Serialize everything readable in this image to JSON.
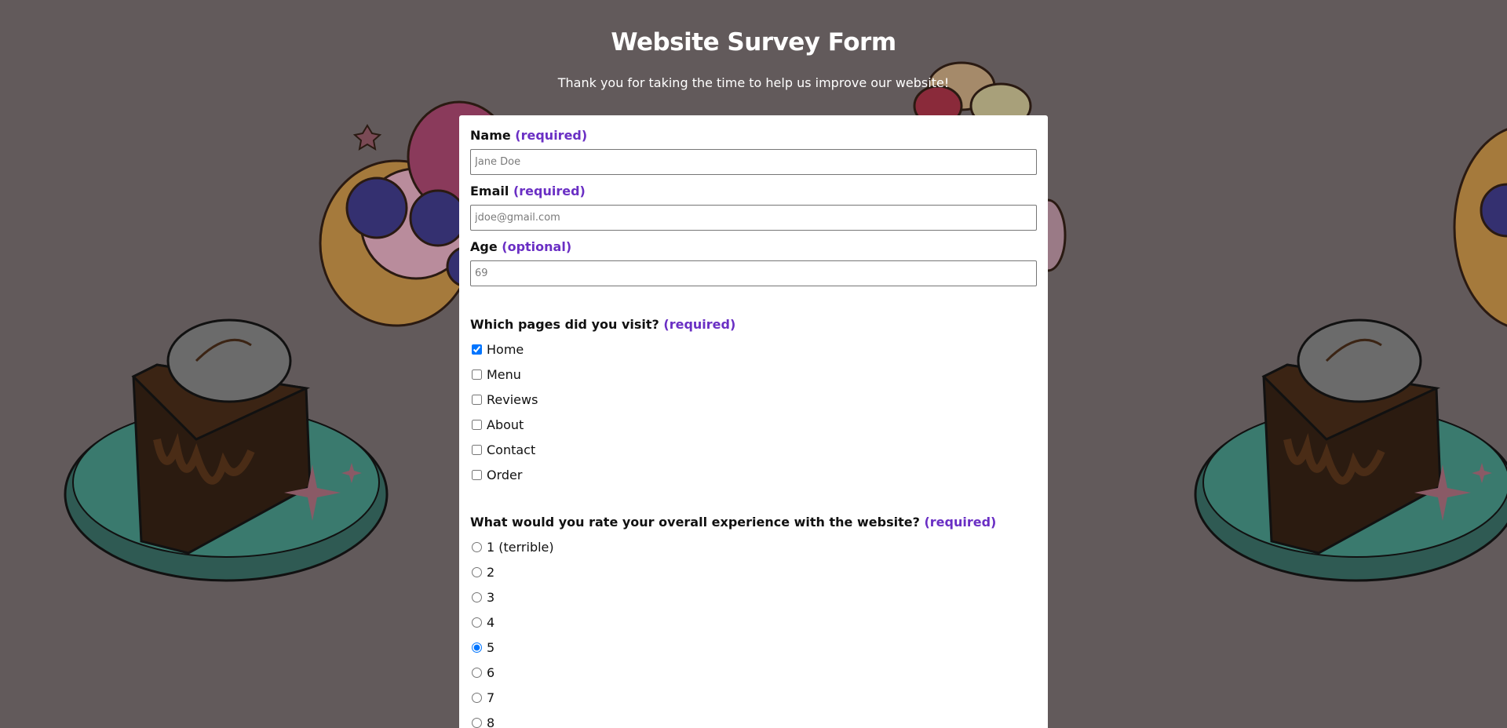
{
  "header": {
    "title": "Website Survey Form",
    "subtitle": "Thank you for taking the time to help us improve our website!"
  },
  "form": {
    "name": {
      "label": "Name",
      "tag": "(required)",
      "placeholder": "Jane Doe"
    },
    "email": {
      "label": "Email",
      "tag": "(required)",
      "placeholder": "jdoe@gmail.com"
    },
    "age": {
      "label": "Age",
      "tag": "(optional)",
      "placeholder": "69"
    },
    "pages": {
      "question": "Which pages did you visit?",
      "tag": "(required)",
      "options": [
        {
          "label": "Home",
          "checked": true
        },
        {
          "label": "Menu",
          "checked": false
        },
        {
          "label": "Reviews",
          "checked": false
        },
        {
          "label": "About",
          "checked": false
        },
        {
          "label": "Contact",
          "checked": false
        },
        {
          "label": "Order",
          "checked": false
        }
      ]
    },
    "rating": {
      "question": "What would you rate your overall experience with the website?",
      "tag": "(required)",
      "selected": "5",
      "options": [
        "1 (terrible)",
        "2",
        "3",
        "4",
        "5",
        "6",
        "7",
        "8"
      ]
    }
  },
  "colors": {
    "background": "#625a5b",
    "accent": "#6a2fc4",
    "card": "#ffffff"
  }
}
